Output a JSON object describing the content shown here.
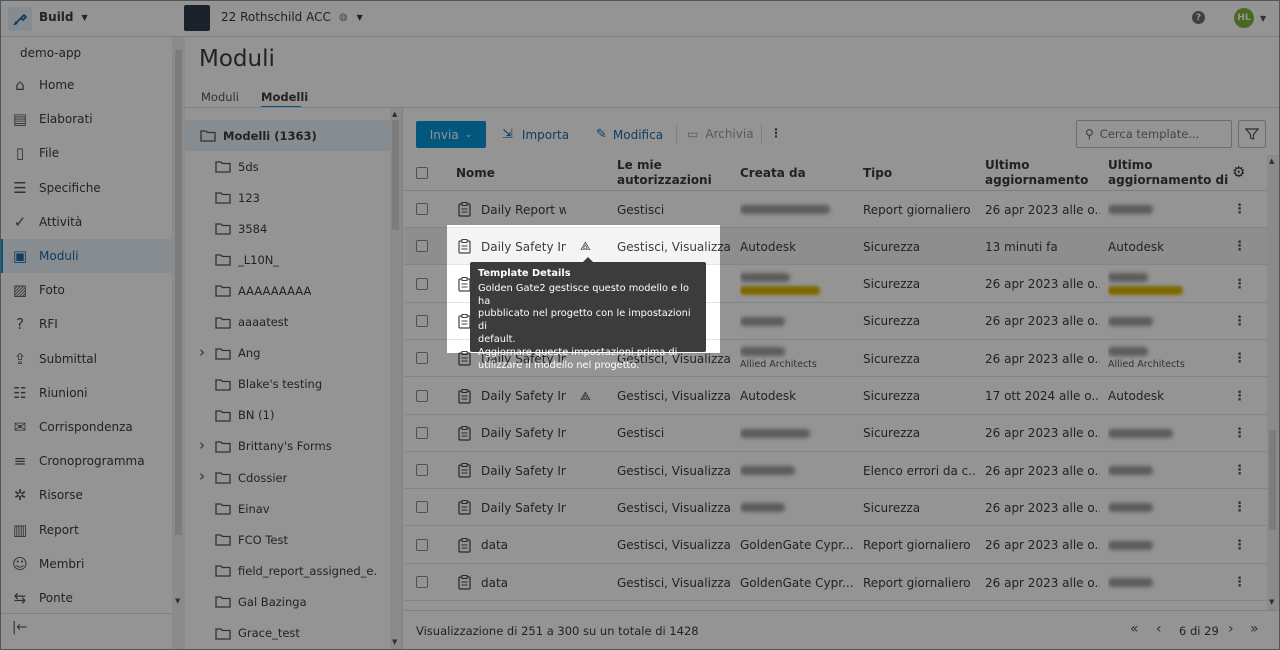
{
  "topbar": {
    "app_name": "Build",
    "project_name": "22 Rothschild ACC",
    "help_icon": "help-icon",
    "avatar_initials": "HL"
  },
  "sidebar": {
    "account": "demo-app",
    "items": [
      {
        "label": "Home",
        "icon": "home-icon"
      },
      {
        "label": "Elaborati",
        "icon": "sheets-icon"
      },
      {
        "label": "File",
        "icon": "file-icon"
      },
      {
        "label": "Specifiche",
        "icon": "specs-icon"
      },
      {
        "label": "Attività",
        "icon": "check-circle-icon"
      },
      {
        "label": "Moduli",
        "icon": "clipboard-icon"
      },
      {
        "label": "Foto",
        "icon": "photo-icon"
      },
      {
        "label": "RFI",
        "icon": "rfi-icon"
      },
      {
        "label": "Submittal",
        "icon": "submittal-icon"
      },
      {
        "label": "Riunioni",
        "icon": "meetings-icon"
      },
      {
        "label": "Corrispondenza",
        "icon": "mail-icon"
      },
      {
        "label": "Cronoprogramma",
        "icon": "schedule-icon"
      },
      {
        "label": "Risorse",
        "icon": "assets-icon"
      },
      {
        "label": "Report",
        "icon": "report-icon"
      },
      {
        "label": "Membri",
        "icon": "members-icon"
      },
      {
        "label": "Ponte",
        "icon": "bridge-icon"
      }
    ],
    "active_index": 5
  },
  "page": {
    "title": "Moduli",
    "tabs": [
      "Moduli",
      "Modelli"
    ],
    "active_tab": 1
  },
  "tree": {
    "root": "Modelli (1363)",
    "items": [
      {
        "label": "5ds",
        "expandable": false
      },
      {
        "label": "123",
        "expandable": false
      },
      {
        "label": "3584",
        "expandable": false
      },
      {
        "label": "_L10N_",
        "expandable": false
      },
      {
        "label": "AAAAAAAAA",
        "expandable": false
      },
      {
        "label": "aaaatest",
        "expandable": false
      },
      {
        "label": "Ang",
        "expandable": true
      },
      {
        "label": "Blake's testing",
        "expandable": false
      },
      {
        "label": "BN (1)",
        "expandable": false
      },
      {
        "label": "Brittany's Forms",
        "expandable": true
      },
      {
        "label": "Cdossier",
        "expandable": true
      },
      {
        "label": "Einav",
        "expandable": false
      },
      {
        "label": "FCO Test",
        "expandable": false
      },
      {
        "label": "field_report_assigned_e...",
        "expandable": false
      },
      {
        "label": "Gal Bazinga",
        "expandable": false
      },
      {
        "label": "Grace_test",
        "expandable": false
      }
    ]
  },
  "toolbar": {
    "send": "Invia",
    "import": "Importa",
    "edit": "Modifica",
    "archive": "Archivia",
    "search_placeholder": "Cerca template..."
  },
  "table": {
    "headers": {
      "name": "Nome",
      "perms_1": "Le mie",
      "perms_2": "autorizzazioni",
      "created": "Creata da",
      "type": "Tipo",
      "updated_1": "Ultimo",
      "updated_2": "aggiornamento",
      "updated_by_1": "Ultimo",
      "updated_by_2": "aggiornamento di"
    },
    "rows": [
      {
        "name": "Daily Report with",
        "perms": "Gestisci",
        "created": "",
        "created_sub": "",
        "type": "Report giornaliero",
        "updated": "26 apr 2023 alle o...",
        "updated_by": "",
        "updated_by_sub": "",
        "hub": false
      },
      {
        "name": "Daily Safety Insp",
        "perms": "Gestisci, Visualizza",
        "created": "Autodesk",
        "created_sub": "",
        "type": "Sicurezza",
        "updated": "13 minuti fa",
        "updated_by": "Autodesk",
        "updated_by_sub": "",
        "hub": true
      },
      {
        "name": "",
        "perms": "",
        "created": "",
        "created_sub": "",
        "type": "Sicurezza",
        "updated": "26 apr 2023 alle o...",
        "updated_by": "",
        "updated_by_sub": "",
        "hub": false
      },
      {
        "name": "",
        "perms": "",
        "created": "",
        "created_sub": "",
        "type": "Sicurezza",
        "updated": "26 apr 2023 alle o...",
        "updated_by": "",
        "updated_by_sub": "",
        "hub": false
      },
      {
        "name": "Daily Safety Insp",
        "perms": "Gestisci, Visualizza",
        "created": "",
        "created_sub": "Allied Architects",
        "type": "Sicurezza",
        "updated": "26 apr 2023 alle o...",
        "updated_by": "",
        "updated_by_sub": "Allied Architects",
        "hub": false
      },
      {
        "name": "Daily Safety Insp",
        "perms": "Gestisci, Visualizza",
        "created": "Autodesk",
        "created_sub": "",
        "type": "Sicurezza",
        "updated": "17 ott 2024 alle o...",
        "updated_by": "Autodesk",
        "updated_by_sub": "",
        "hub": true
      },
      {
        "name": "Daily Safety Insp",
        "perms": "Gestisci",
        "created": "",
        "created_sub": "",
        "type": "Sicurezza",
        "updated": "26 apr 2023 alle o...",
        "updated_by": "",
        "updated_by_sub": "",
        "hub": false
      },
      {
        "name": "Daily Safety Insp",
        "perms": "Gestisci, Visualizza",
        "created": "",
        "created_sub": "",
        "type": "Elenco errori da c...",
        "updated": "26 apr 2023 alle o...",
        "updated_by": "",
        "updated_by_sub": "",
        "hub": false
      },
      {
        "name": "Daily Safety Insp",
        "perms": "Gestisci, Visualizza",
        "created": "",
        "created_sub": "",
        "type": "Sicurezza",
        "updated": "26 apr 2023 alle o...",
        "updated_by": "",
        "updated_by_sub": "",
        "hub": false
      },
      {
        "name": "data",
        "perms": "Gestisci, Visualizza",
        "created": "GoldenGate Cypr...",
        "created_sub": "",
        "type": "Report giornaliero",
        "updated": "26 apr 2023 alle o...",
        "updated_by": "",
        "updated_by_sub": "",
        "hub": false
      },
      {
        "name": "data",
        "perms": "Gestisci, Visualizza",
        "created": "GoldenGate Cypr...",
        "created_sub": "",
        "type": "Report giornaliero",
        "updated": "26 apr 2023 alle o...",
        "updated_by": "",
        "updated_by_sub": "",
        "hub": false
      }
    ]
  },
  "pagination": {
    "summary": "Visualizzazione di 251 a 300 su un totale di 1428",
    "page": "6 di 29"
  },
  "tooltip": {
    "title": "Template Details",
    "lines": [
      "Golden Gate2 gestisce questo modello e lo ha",
      "pubblicato nel progetto con le impostazioni di",
      "default.",
      "Aggiornare queste impostazioni prima di",
      "utilizzare il modello nel progetto."
    ]
  },
  "colors": {
    "accent": "#0696d7",
    "link": "#1d69a6",
    "tooltip_bg": "#3c3c3c",
    "overlay": "rgba(0,0,0,0.42)"
  }
}
